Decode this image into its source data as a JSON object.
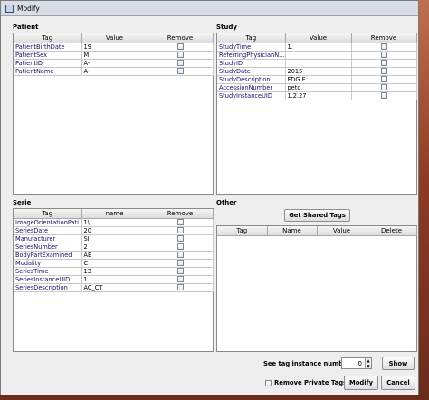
{
  "window": {
    "title": "Modify"
  },
  "patient": {
    "title": "Patient",
    "columns": [
      "Tag",
      "Value",
      "Remove"
    ],
    "rows": [
      {
        "tag": "PatientBirthDate",
        "value": "19"
      },
      {
        "tag": "PatientSex",
        "value": "M"
      },
      {
        "tag": "PatientID",
        "value": "A-"
      },
      {
        "tag": "PatientName",
        "value": "A-"
      }
    ]
  },
  "study": {
    "title": "Study",
    "columns": [
      "Tag",
      "Value",
      "Remove"
    ],
    "rows": [
      {
        "tag": "StudyTime",
        "value": "1."
      },
      {
        "tag": "ReferringPhysicianN...",
        "value": ""
      },
      {
        "tag": "StudyID",
        "value": ""
      },
      {
        "tag": "StudyDate",
        "value": "2015"
      },
      {
        "tag": "StudyDescription",
        "value": "FDG F"
      },
      {
        "tag": "AccessionNumber",
        "value": "petc"
      },
      {
        "tag": "StudyInstanceUID",
        "value": "1.2.27"
      }
    ]
  },
  "serie": {
    "title": "Serie",
    "columns": [
      "Tag",
      "name",
      "Remove"
    ],
    "rows": [
      {
        "tag": "ImageOrientationPati...",
        "value": "1\\"
      },
      {
        "tag": "SeriesDate",
        "value": "20"
      },
      {
        "tag": "Manufacturer",
        "value": "SI"
      },
      {
        "tag": "SeriesNumber",
        "value": "2"
      },
      {
        "tag": "BodyPartExamined",
        "value": "AE"
      },
      {
        "tag": "Modality",
        "value": "C"
      },
      {
        "tag": "SeriesTime",
        "value": "13"
      },
      {
        "tag": "SeriesInstanceUID",
        "value": "1."
      },
      {
        "tag": "SeriesDescription",
        "value": "AC_CT"
      }
    ]
  },
  "other": {
    "title": "Other",
    "get_shared_tags": "Get Shared Tags",
    "columns": [
      "Tag",
      "Name",
      "Value",
      "Delete"
    ]
  },
  "footer": {
    "instance_label": "See tag instance number",
    "instance_value": "0",
    "show_button": "Show",
    "remove_private_label": "Remove Private Tags",
    "modify_button": "Modify",
    "cancel_button": "Cancel"
  }
}
